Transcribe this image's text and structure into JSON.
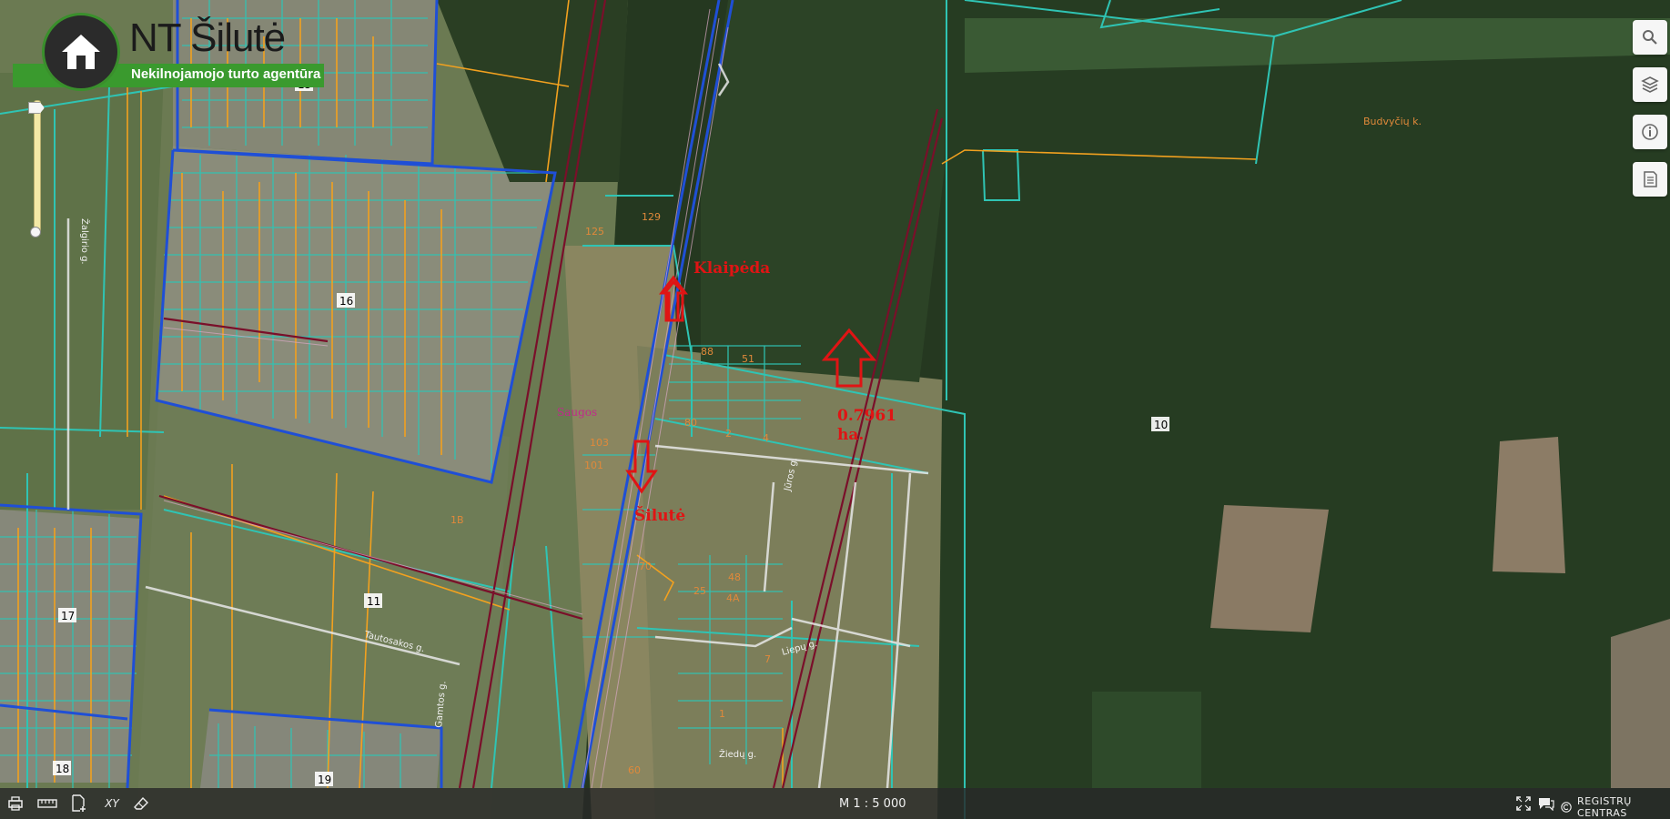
{
  "logo": {
    "title": "NT Šilutė",
    "subtitle": "Nekilnojamojo turto agentūra"
  },
  "annotations": {
    "klaipeda": "Klaipėda",
    "silute": "Šilutė",
    "area_value": "0.7961",
    "area_unit": "ha."
  },
  "place_labels": {
    "saugos": "Saugos",
    "budviecio": "Budvyčių k."
  },
  "street_labels": {
    "zalgirio": "Žalgirio g.",
    "tautos": "Tautosakos g.",
    "zieduj": "Žiedų g.",
    "juros": "Jūros g.",
    "gamtos": "Gamtos g.",
    "liepu": "Liepų g."
  },
  "parcel_numbers": {
    "n15": "15",
    "n16": "16",
    "n17": "17",
    "n18": "18",
    "n19": "19",
    "n10": "10",
    "n11": "11",
    "n1b": "1B",
    "n125": "125",
    "n129": "129",
    "n88": "88",
    "n51": "51",
    "n80": "80",
    "n103": "103",
    "n101": "101",
    "n25": "25",
    "n48": "48",
    "n4a": "4A",
    "n70": "70",
    "n7": "7",
    "n1": "1",
    "n60": "60",
    "n2": "2",
    "n4": "4"
  },
  "toolbar_right": {
    "search": "search-icon",
    "layers": "layers-icon",
    "info": "info-icon",
    "legend": "legend-icon"
  },
  "bottombar": {
    "scale": "M 1 : 5 000",
    "brand": "REGISTRŲ CENTRAS"
  },
  "colors": {
    "parcel_cyan": "#2fc4b4",
    "parcel_orange": "#f2a11f",
    "boundary_blue": "#1f4fd6",
    "rail_red": "#7a0f2a",
    "arrow_red": "#e01414",
    "logo_green": "#3a9a2e"
  }
}
